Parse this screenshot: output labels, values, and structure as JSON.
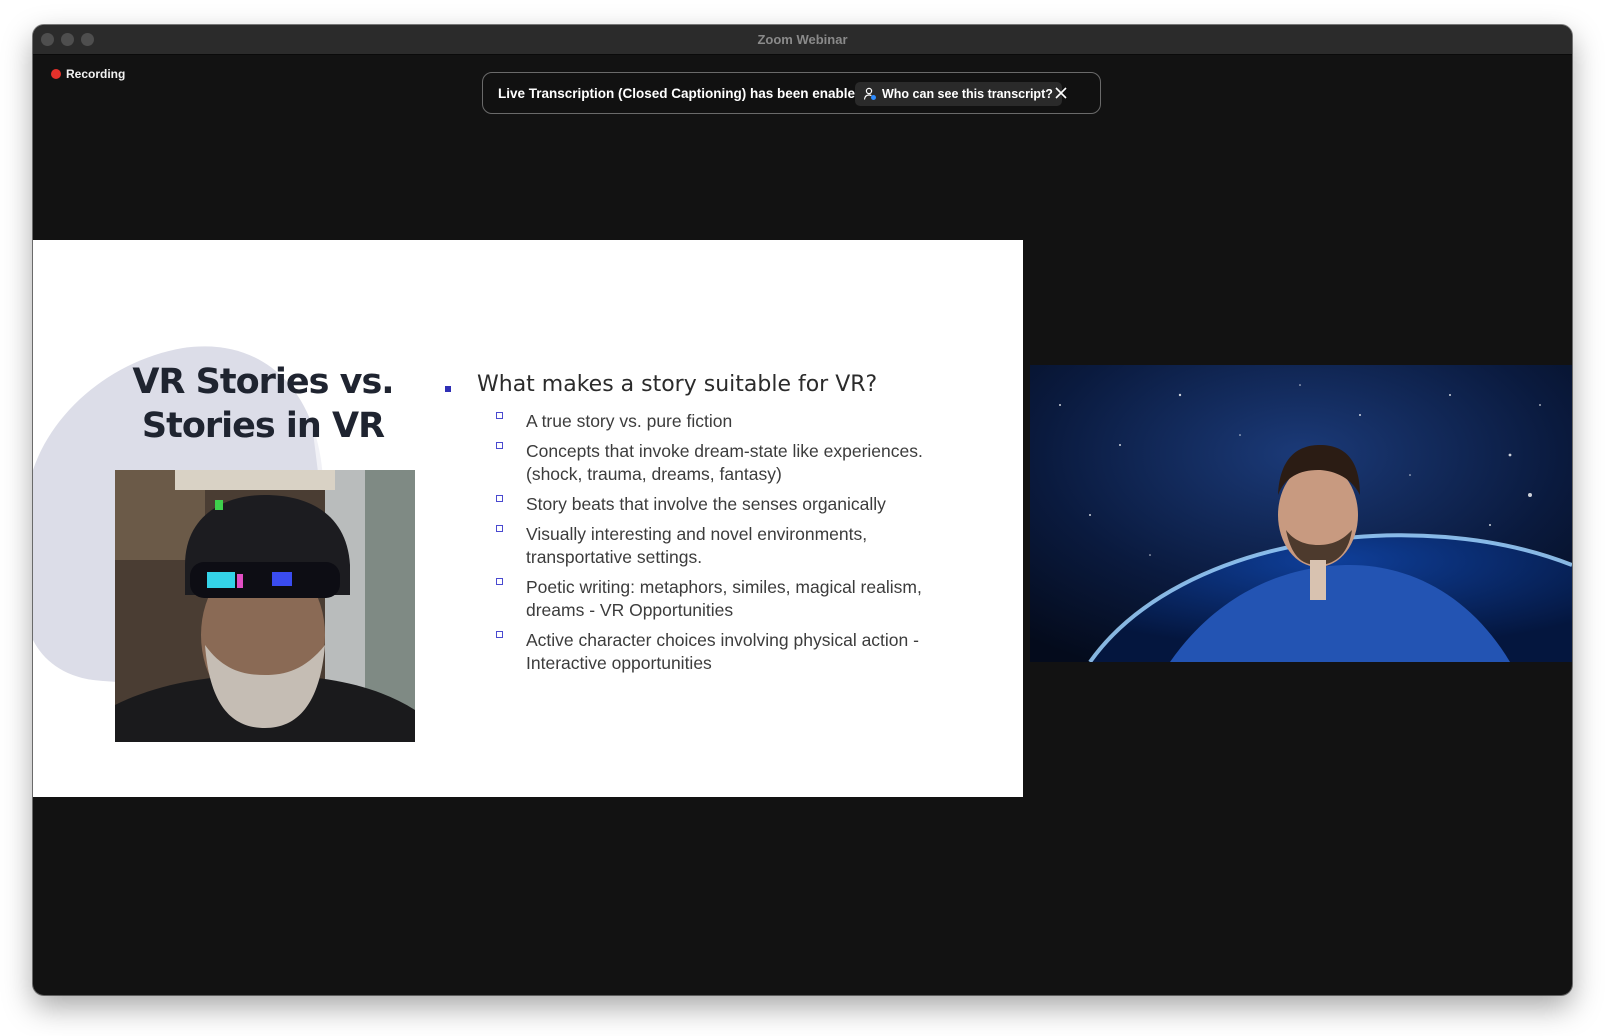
{
  "window": {
    "title": "Zoom Webinar",
    "recording_label": "Recording"
  },
  "banner": {
    "text": "Live Transcription (Closed Captioning) has been enabled",
    "button_label": "Who can see this transcript?"
  },
  "slide": {
    "title_line1": "VR Stories vs.",
    "title_line2": "Stories in VR",
    "main_point": "What makes a story suitable for VR?",
    "sub_points": [
      "A true story vs. pure fiction",
      "Concepts that invoke dream-state like experiences. (shock, trauma, dreams, fantasy)",
      "Story beats that involve the senses organically",
      "Visually interesting and novel environments, transportative settings.",
      "Poetic writing: metaphors, similes, magical realism, dreams - VR Opportunities",
      "Active character choices involving physical action - Interactive opportunities"
    ]
  },
  "colors": {
    "window_bg": "#121212",
    "recording_dot": "#e5312b",
    "bullet_accent": "#2f2fb5"
  }
}
